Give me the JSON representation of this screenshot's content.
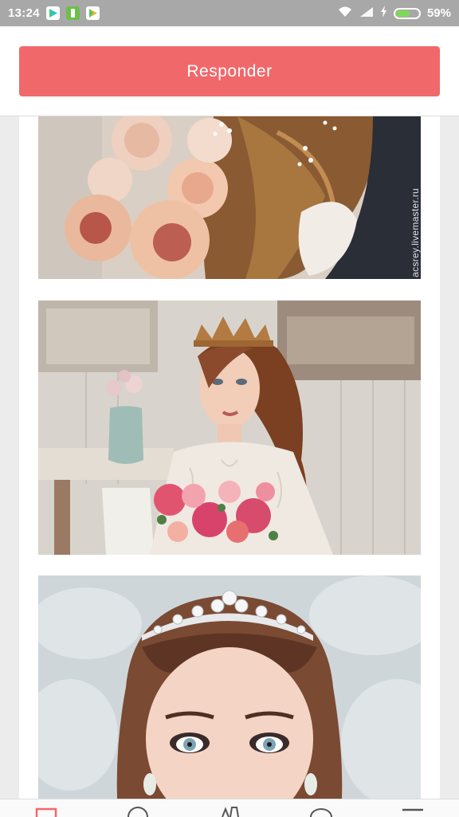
{
  "status_bar": {
    "time": "13:24",
    "battery_percent": "59%",
    "battery_level": 0.59,
    "icons": [
      "play-store-icon",
      "battery-saver-icon",
      "play-store-icon",
      "wifi-icon",
      "signal-icon",
      "charging-icon",
      "battery-icon"
    ]
  },
  "header": {
    "reply_label": "Responder"
  },
  "photos": [
    {
      "id": "photo-1",
      "watermark": "acsrey.livemaster.ru"
    },
    {
      "id": "photo-2"
    },
    {
      "id": "photo-3"
    }
  ],
  "bottom_nav": {
    "icons": [
      "tab-home-icon",
      "tab-search-icon",
      "tab-vendors-icon",
      "tab-chat-icon",
      "tab-menu-icon"
    ]
  },
  "colors": {
    "accent": "#f1686a",
    "status_bar": "#a8a8a8",
    "background": "#ececec"
  }
}
